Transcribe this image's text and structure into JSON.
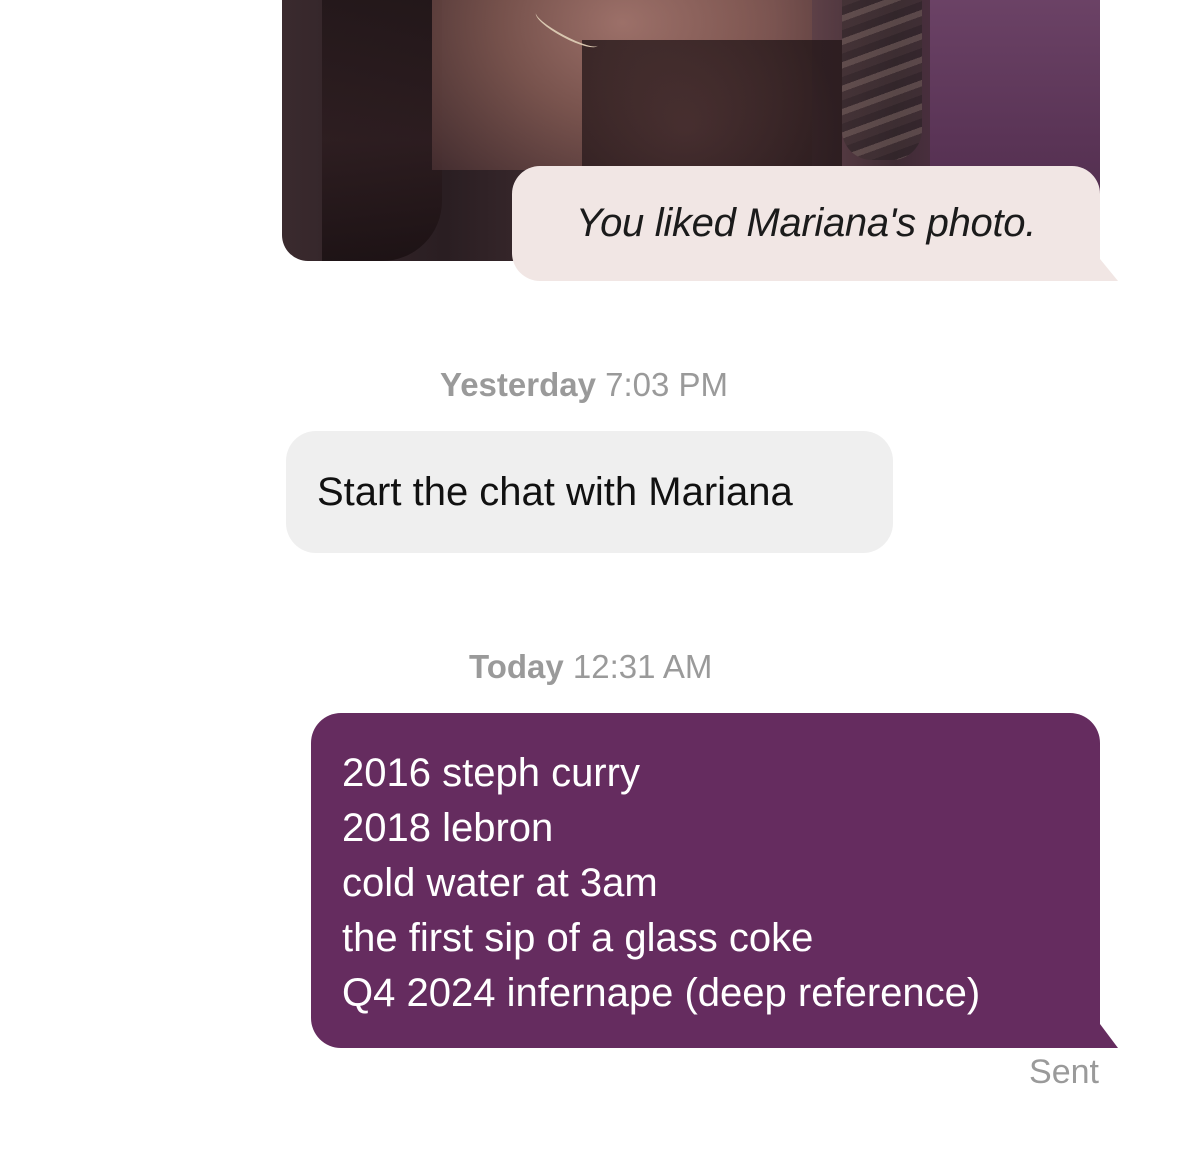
{
  "conversation": {
    "liked_notice": "You liked Mariana's photo.",
    "groups": {
      "yesterday": {
        "day": "Yesterday",
        "time": "7:03 PM"
      },
      "today": {
        "day": "Today",
        "time": "12:31 AM"
      }
    },
    "incoming_prompt": "Start the chat with Mariana",
    "outgoing_message": {
      "lines": [
        "2016 steph curry",
        "2018 lebron",
        "cold water at 3am",
        "the first sip of a glass coke",
        "Q4 2024 infernape (deep reference)"
      ],
      "status": "Sent"
    }
  },
  "colors": {
    "outgoing_bubble": "#652c5f",
    "incoming_bubble": "#efefef",
    "liked_bubble": "#f1e6e4",
    "timestamp_text": "#9a9a9a"
  }
}
